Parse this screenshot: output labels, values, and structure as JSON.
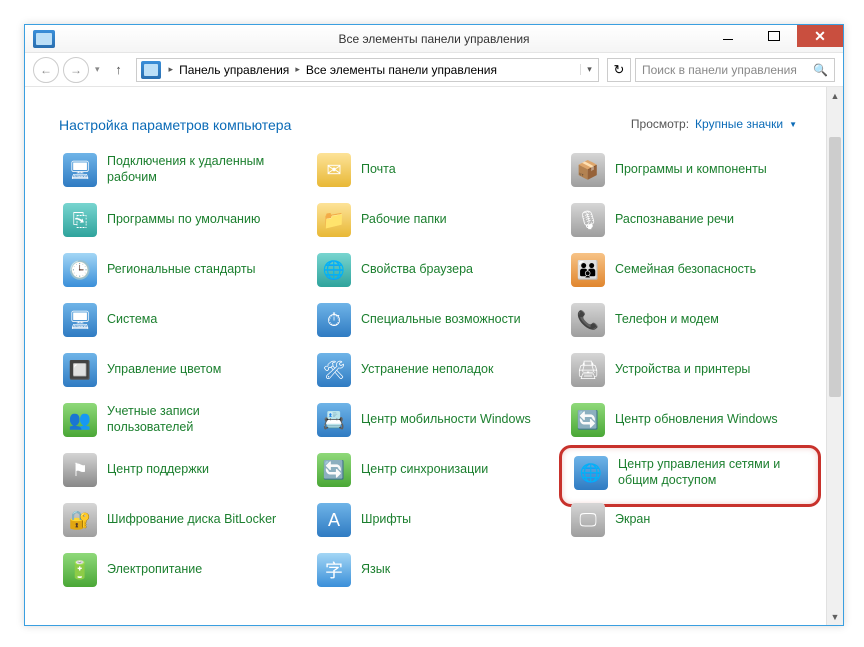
{
  "window": {
    "title": "Все элементы панели управления",
    "min": "",
    "max": "",
    "close": "✕"
  },
  "nav": {
    "back": "←",
    "fwd": "→",
    "dd": "▾",
    "up": "↑",
    "refresh": "↻",
    "seg1": "Панель управления",
    "seg2": "Все элементы панели управления"
  },
  "search": {
    "placeholder": "Поиск в панели управления"
  },
  "heading": "Настройка параметров компьютера",
  "view": {
    "label": "Просмотр:",
    "value": "Крупные значки"
  },
  "items": [
    {
      "id": "remote-desktop",
      "label": "Подключения к удаленным рабочим",
      "glyph": "🖥",
      "cls": "i-blue"
    },
    {
      "id": "mail",
      "label": "Почта",
      "glyph": "✉",
      "cls": "i-yellow"
    },
    {
      "id": "programs-features",
      "label": "Программы и компоненты",
      "glyph": "📦",
      "cls": "i-grey"
    },
    {
      "id": "default-programs",
      "label": "Программы по умолчанию",
      "glyph": "⎘",
      "cls": "i-teal"
    },
    {
      "id": "work-folders",
      "label": "Рабочие папки",
      "glyph": "📁",
      "cls": "i-yellow"
    },
    {
      "id": "speech",
      "label": "Распознавание речи",
      "glyph": "🎙",
      "cls": "i-grey"
    },
    {
      "id": "region",
      "label": "Региональные стандарты",
      "glyph": "🕒",
      "cls": "i-globe"
    },
    {
      "id": "internet-options",
      "label": "Свойства браузера",
      "glyph": "🌐",
      "cls": "i-teal"
    },
    {
      "id": "family-safety",
      "label": "Семейная безопасность",
      "glyph": "👪",
      "cls": "i-orange"
    },
    {
      "id": "system",
      "label": "Система",
      "glyph": "🖥",
      "cls": "i-blue"
    },
    {
      "id": "ease-of-access",
      "label": "Специальные возможности",
      "glyph": "⏱",
      "cls": "i-blue"
    },
    {
      "id": "phone-modem",
      "label": "Телефон и модем",
      "glyph": "📞",
      "cls": "i-grey"
    },
    {
      "id": "color-mgmt",
      "label": "Управление цветом",
      "glyph": "🔲",
      "cls": "i-blue"
    },
    {
      "id": "troubleshoot",
      "label": "Устранение неполадок",
      "glyph": "🛠",
      "cls": "i-blue"
    },
    {
      "id": "devices-printers",
      "label": "Устройства и принтеры",
      "glyph": "🖨",
      "cls": "i-grey"
    },
    {
      "id": "user-accounts",
      "label": "Учетные записи пользователей",
      "glyph": "👥",
      "cls": "i-green"
    },
    {
      "id": "mobility-center",
      "label": "Центр мобильности Windows",
      "glyph": "📇",
      "cls": "i-blue"
    },
    {
      "id": "windows-update",
      "label": "Центр обновления Windows",
      "glyph": "🔄",
      "cls": "i-green"
    },
    {
      "id": "action-center",
      "label": "Центр поддержки",
      "glyph": "⚑",
      "cls": "i-flag"
    },
    {
      "id": "sync-center",
      "label": "Центр синхронизации",
      "glyph": "🔄",
      "cls": "i-green"
    },
    {
      "id": "network-sharing",
      "label": "Центр управления сетями и общим доступом",
      "glyph": "🌐",
      "cls": "i-blue",
      "highlight": true
    },
    {
      "id": "bitlocker",
      "label": "Шифрование диска BitLocker",
      "glyph": "🔐",
      "cls": "i-grey"
    },
    {
      "id": "fonts",
      "label": "Шрифты",
      "glyph": "A",
      "cls": "i-blue"
    },
    {
      "id": "display",
      "label": "Экран",
      "glyph": "🖵",
      "cls": "i-grey"
    },
    {
      "id": "power",
      "label": "Электропитание",
      "glyph": "🔋",
      "cls": "i-green"
    },
    {
      "id": "language",
      "label": "Язык",
      "glyph": "字",
      "cls": "i-globe"
    }
  ]
}
